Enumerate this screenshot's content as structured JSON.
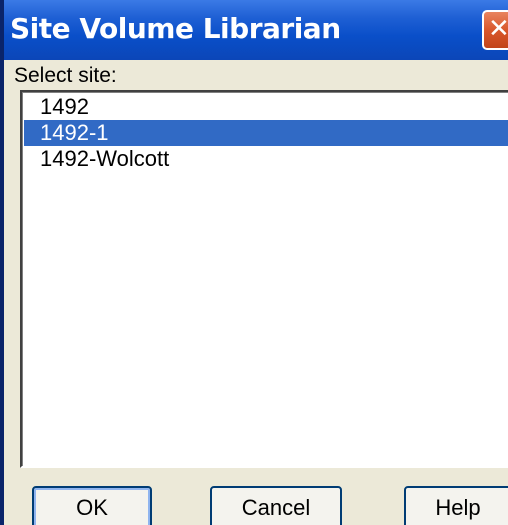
{
  "window": {
    "title": "Site Volume Librarian",
    "close_glyph": "✕",
    "close_icon": "close-icon"
  },
  "main": {
    "select_label": "Select site:",
    "sites": [
      {
        "label": "1492",
        "selected": false
      },
      {
        "label": "1492-1",
        "selected": true
      },
      {
        "label": "1492-Wolcott",
        "selected": false
      }
    ]
  },
  "buttons": {
    "ok_label": "OK",
    "cancel_label": "Cancel",
    "help_label": "Help"
  },
  "colors": {
    "titlebar": "#0a4fc9",
    "selection": "#316ac5",
    "close_button": "#d9572c",
    "dialog_background": "#ece9d8"
  }
}
